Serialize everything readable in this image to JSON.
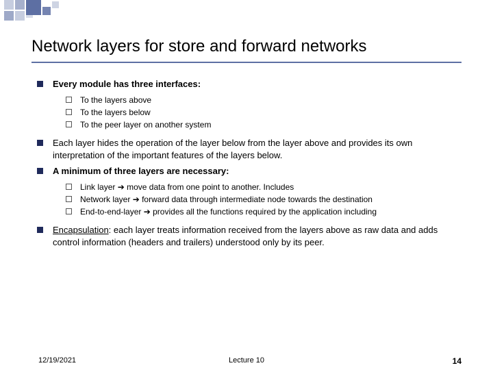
{
  "title": "Network layers for store and forward networks",
  "points": [
    {
      "text_bold": "Every module has three interfaces:",
      "sub": [
        {
          "text": "To the layers above"
        },
        {
          "text": "To the layers below"
        },
        {
          "text": "To the peer layer on another system"
        }
      ]
    },
    {
      "text_plain": "Each layer hides the operation of the layer below from the layer above and provides its own interpretation of the important features of the layers below."
    },
    {
      "text_bold": "A minimum of three layers are necessary:",
      "sub": [
        {
          "lead": "Link layer",
          "arrow": "➔",
          "rest": " move data from one point to another. Includes"
        },
        {
          "lead": "Network layer",
          "arrow": "➔",
          "rest": " forward data through intermediate node towards the destination"
        },
        {
          "lead": "End-to-end-layer",
          "arrow": "➔",
          "rest": " provides all the functions required by the application including"
        }
      ]
    },
    {
      "encap_label": "Encapsulation",
      "encap_rest": ": each layer treats information received from the layers above as raw data and adds control information  (headers and trailers) understood only by its peer."
    }
  ],
  "footer": {
    "date": "12/19/2021",
    "center": "Lecture 10",
    "page": "14"
  }
}
